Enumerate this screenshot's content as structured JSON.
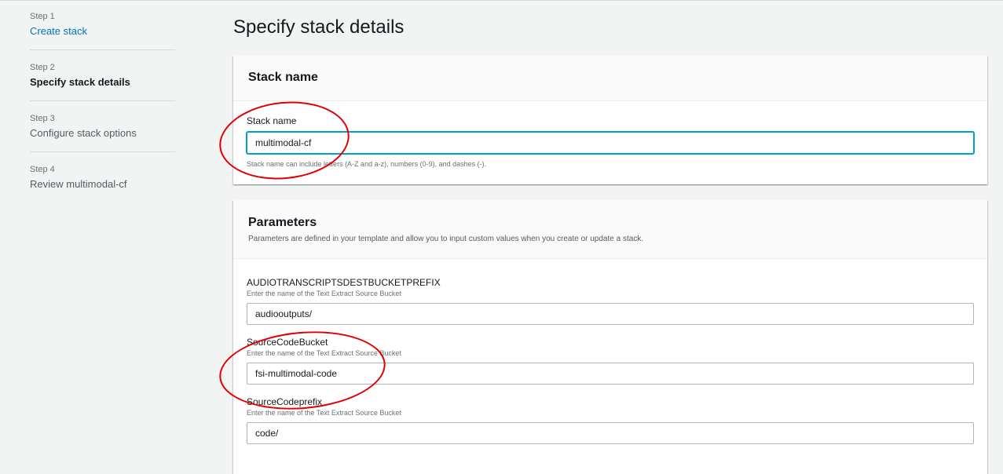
{
  "steps": [
    {
      "number": "Step 1",
      "title": "Create stack"
    },
    {
      "number": "Step 2",
      "title": "Specify stack details"
    },
    {
      "number": "Step 3",
      "title": "Configure stack options"
    },
    {
      "number": "Step 4",
      "title": "Review multimodal-cf"
    }
  ],
  "page_title": "Specify stack details",
  "stack_panel": {
    "title": "Stack name",
    "field_label": "Stack name",
    "value": "multimodal-cf",
    "hint": "Stack name can include letters (A-Z and a-z), numbers (0-9), and dashes (-)."
  },
  "params_panel": {
    "title": "Parameters",
    "subtitle": "Parameters are defined in your template and allow you to input custom values when you create or update a stack.",
    "fields": [
      {
        "label": "AUDIOTRANSCRIPTSDESTBUCKETPREFIX",
        "description": "Enter the name of the Text Extract Source Bucket",
        "value": "audiooutputs/"
      },
      {
        "label": "SourceCodeBucket",
        "description": "Enter the name of the Text Extract Source Bucket",
        "value": "fsi-multimodal-code"
      },
      {
        "label": "SourceCodeprefix",
        "description": "Enter the name of the Text Extract Source Bucket",
        "value": "code/"
      }
    ]
  },
  "colors": {
    "link": "#0073bb",
    "focus": "#00a1c9",
    "annotation": "#e00000"
  }
}
